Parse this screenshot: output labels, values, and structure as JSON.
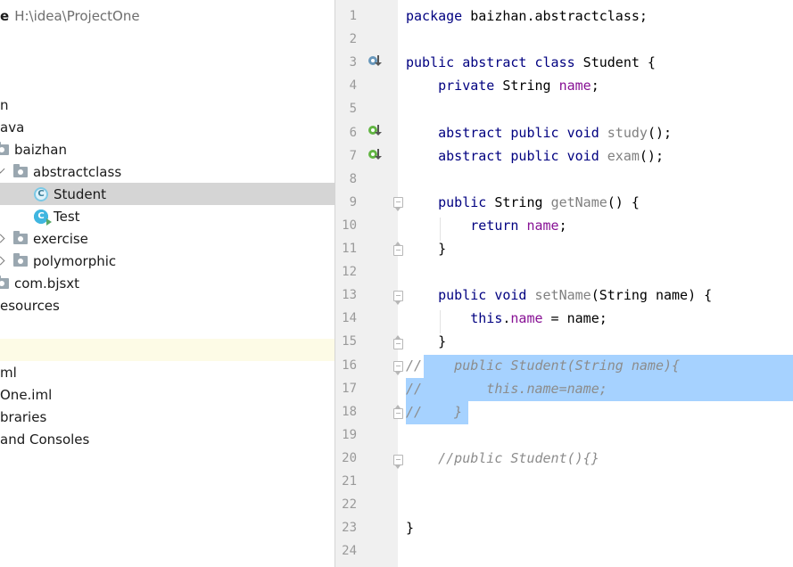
{
  "project_tree": {
    "root": {
      "name": "e",
      "path": "H:\\idea\\ProjectOne"
    },
    "items": [
      {
        "label": "n"
      },
      {
        "label": "ava"
      },
      {
        "label": "baizhan"
      },
      {
        "label": "abstractclass"
      },
      {
        "label": "Student"
      },
      {
        "label": "Test"
      },
      {
        "label": "exercise"
      },
      {
        "label": "polymorphic"
      },
      {
        "label": "com.bjsxt"
      },
      {
        "label": "esources"
      },
      {
        "label": "ml"
      },
      {
        "label": "One.iml"
      },
      {
        "label": "braries"
      },
      {
        "label": "and Consoles"
      }
    ]
  },
  "editor": {
    "line_numbers": [
      "1",
      "2",
      "3",
      "4",
      "5",
      "6",
      "7",
      "8",
      "9",
      "10",
      "11",
      "12",
      "13",
      "14",
      "15",
      "16",
      "17",
      "18",
      "19",
      "20",
      "21",
      "22",
      "23",
      "24"
    ],
    "colors": {
      "keyword": "#000080",
      "field": "#871094",
      "method_unused": "#808080",
      "comment": "#8c8c8c",
      "selection": "#a6d2ff",
      "selected_tree_row": "#d5d5d5"
    },
    "lines": [
      [
        {
          "t": "package",
          "c": "kw"
        },
        {
          "t": " baizhan.abstractclass;",
          "c": ""
        }
      ],
      [],
      [
        {
          "t": "public abstract class",
          "c": "kw"
        },
        {
          "t": " Student {",
          "c": ""
        }
      ],
      [
        {
          "t": "    ",
          "c": ""
        },
        {
          "t": "private",
          "c": "kw"
        },
        {
          "t": " String ",
          "c": ""
        },
        {
          "t": "name",
          "c": "fld"
        },
        {
          "t": ";",
          "c": ""
        }
      ],
      [],
      [
        {
          "t": "    ",
          "c": ""
        },
        {
          "t": "abstract public void",
          "c": "kw"
        },
        {
          "t": " ",
          "c": ""
        },
        {
          "t": "study",
          "c": "mth"
        },
        {
          "t": "();",
          "c": ""
        }
      ],
      [
        {
          "t": "    ",
          "c": ""
        },
        {
          "t": "abstract public void",
          "c": "kw"
        },
        {
          "t": " ",
          "c": ""
        },
        {
          "t": "exam",
          "c": "mth"
        },
        {
          "t": "();",
          "c": ""
        }
      ],
      [],
      [
        {
          "t": "    ",
          "c": ""
        },
        {
          "t": "public",
          "c": "kw"
        },
        {
          "t": " String ",
          "c": ""
        },
        {
          "t": "getName",
          "c": "mth"
        },
        {
          "t": "() {",
          "c": ""
        }
      ],
      [
        {
          "t": "        ",
          "c": ""
        },
        {
          "t": "return",
          "c": "kw"
        },
        {
          "t": " ",
          "c": ""
        },
        {
          "t": "name",
          "c": "fld"
        },
        {
          "t": ";",
          "c": ""
        }
      ],
      [
        {
          "t": "    }",
          "c": ""
        }
      ],
      [],
      [
        {
          "t": "    ",
          "c": ""
        },
        {
          "t": "public void",
          "c": "kw"
        },
        {
          "t": " ",
          "c": ""
        },
        {
          "t": "setName",
          "c": "mth"
        },
        {
          "t": "(String name) {",
          "c": ""
        }
      ],
      [
        {
          "t": "        ",
          "c": ""
        },
        {
          "t": "this",
          "c": "kw"
        },
        {
          "t": ".",
          "c": ""
        },
        {
          "t": "name",
          "c": "fld"
        },
        {
          "t": " = name;",
          "c": ""
        }
      ],
      [
        {
          "t": "    }",
          "c": ""
        }
      ],
      [
        {
          "t": "//    public Student(String name){",
          "c": "cmt"
        }
      ],
      [
        {
          "t": "//        this.name=name;",
          "c": "cmt"
        }
      ],
      [
        {
          "t": "//    }",
          "c": "cmt"
        }
      ],
      [],
      [
        {
          "t": "    //public Student(){}",
          "c": "cmt"
        }
      ],
      [],
      [],
      [
        {
          "t": "}",
          "c": ""
        }
      ],
      []
    ]
  }
}
